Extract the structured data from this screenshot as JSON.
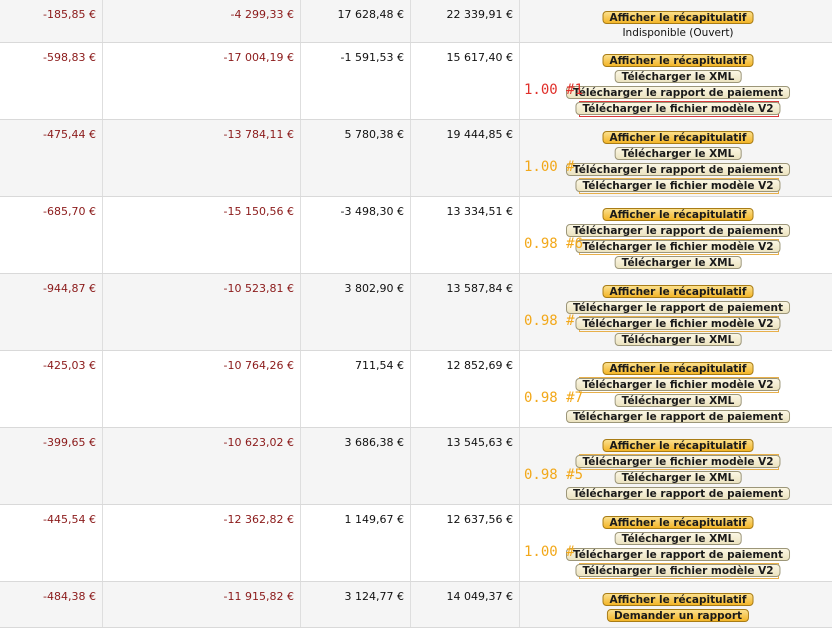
{
  "rows": [
    {
      "c1": "-185,85 €",
      "c2": "-4 299,33 €",
      "c3": "17 628,48 €",
      "c4": "22 339,91 €",
      "score": null,
      "buttons": [
        {
          "label": "Afficher le récapitulatif",
          "kind": "primary"
        }
      ],
      "status": "Indisponible (Ouvert)"
    },
    {
      "c1": "-598,83 €",
      "c2": "-17 004,19 €",
      "c3": "-1 591,53 €",
      "c4": "15 617,40 €",
      "score": {
        "text": "1.00 #1",
        "color": "red"
      },
      "buttons": [
        {
          "label": "Afficher le récapitulatif",
          "kind": "primary"
        },
        {
          "label": "Télécharger le XML",
          "kind": "secondary"
        },
        {
          "label": "Télécharger le rapport de paiement",
          "kind": "secondary"
        },
        {
          "label": "Télécharger le fichier modèle V2",
          "kind": "secondary",
          "highlight": "red"
        }
      ]
    },
    {
      "c1": "-475,44 €",
      "c2": "-13 784,11 €",
      "c3": "5 780,38 €",
      "c4": "19 444,85 €",
      "score": {
        "text": "1.00 #",
        "color": "orange"
      },
      "buttons": [
        {
          "label": "Afficher le récapitulatif",
          "kind": "primary"
        },
        {
          "label": "Télécharger le XML",
          "kind": "secondary"
        },
        {
          "label": "Télécharger le rapport de paiement",
          "kind": "secondary"
        },
        {
          "label": "Télécharger le fichier modèle V2",
          "kind": "secondary",
          "highlight": "orange"
        }
      ]
    },
    {
      "c1": "-685,70 €",
      "c2": "-15 150,56 €",
      "c3": "-3 498,30 €",
      "c4": "13 334,51 €",
      "score": {
        "text": "0.98 #6",
        "color": "orange"
      },
      "buttons": [
        {
          "label": "Afficher le récapitulatif",
          "kind": "primary"
        },
        {
          "label": "Télécharger le rapport de paiement",
          "kind": "secondary"
        },
        {
          "label": "Télécharger le fichier modèle V2",
          "kind": "secondary",
          "highlight": "orange"
        },
        {
          "label": "Télécharger le XML",
          "kind": "secondary"
        }
      ]
    },
    {
      "c1": "-944,87 €",
      "c2": "-10 523,81 €",
      "c3": "3 802,90 €",
      "c4": "13 587,84 €",
      "score": {
        "text": "0.98 #",
        "color": "orange"
      },
      "buttons": [
        {
          "label": "Afficher le récapitulatif",
          "kind": "primary"
        },
        {
          "label": "Télécharger le rapport de paiement",
          "kind": "secondary"
        },
        {
          "label": "Télécharger le fichier modèle V2",
          "kind": "secondary",
          "highlight": "orange"
        },
        {
          "label": "Télécharger le XML",
          "kind": "secondary"
        }
      ]
    },
    {
      "c1": "-425,03 €",
      "c2": "-10 764,26 €",
      "c3": "711,54 €",
      "c4": "12 852,69 €",
      "score": {
        "text": "0.98 #7",
        "color": "orange"
      },
      "buttons": [
        {
          "label": "Afficher le récapitulatif",
          "kind": "primary"
        },
        {
          "label": "Télécharger le fichier modèle V2",
          "kind": "secondary",
          "highlight": "orange"
        },
        {
          "label": "Télécharger le XML",
          "kind": "secondary"
        },
        {
          "label": "Télécharger le rapport de paiement",
          "kind": "secondary"
        }
      ]
    },
    {
      "c1": "-399,65 €",
      "c2": "-10 623,02 €",
      "c3": "3 686,38 €",
      "c4": "13 545,63 €",
      "score": {
        "text": "0.98 #5",
        "color": "orange"
      },
      "buttons": [
        {
          "label": "Afficher le récapitulatif",
          "kind": "primary"
        },
        {
          "label": "Télécharger le fichier modèle V2",
          "kind": "secondary",
          "highlight": "orange"
        },
        {
          "label": "Télécharger le XML",
          "kind": "secondary"
        },
        {
          "label": "Télécharger le rapport de paiement",
          "kind": "secondary"
        }
      ]
    },
    {
      "c1": "-445,54 €",
      "c2": "-12 362,82 €",
      "c3": "1 149,67 €",
      "c4": "12 637,56 €",
      "score": {
        "text": "1.00 #",
        "color": "orange"
      },
      "buttons": [
        {
          "label": "Afficher le récapitulatif",
          "kind": "primary"
        },
        {
          "label": "Télécharger le XML",
          "kind": "secondary"
        },
        {
          "label": "Télécharger le rapport de paiement",
          "kind": "secondary"
        },
        {
          "label": "Télécharger le fichier modèle V2",
          "kind": "secondary",
          "highlight": "orange"
        }
      ]
    },
    {
      "c1": "-484,38 €",
      "c2": "-11 915,82 €",
      "c3": "3 124,77 €",
      "c4": "14 049,37 €",
      "score": null,
      "buttons": [
        {
          "label": "Afficher le récapitulatif",
          "kind": "primary"
        },
        {
          "label": "Demander un rapport",
          "kind": "primary"
        }
      ]
    }
  ]
}
